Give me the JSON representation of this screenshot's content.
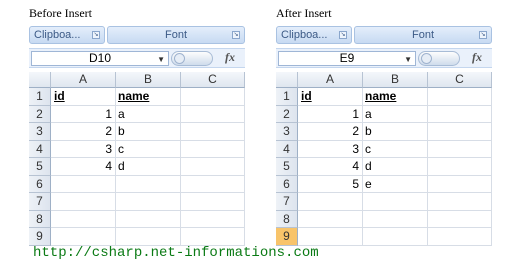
{
  "left": {
    "caption": "Before Insert",
    "ribbon": {
      "clipboard": "Clipboa...",
      "font": "Font"
    },
    "name_box": "D10",
    "fx": "fx",
    "columns": [
      "A",
      "B",
      "C"
    ],
    "rows": [
      {
        "num": "1",
        "a": "id",
        "b": "name",
        "c": ""
      },
      {
        "num": "2",
        "a": "1",
        "b": "a",
        "c": ""
      },
      {
        "num": "3",
        "a": "2",
        "b": "b",
        "c": ""
      },
      {
        "num": "4",
        "a": "3",
        "b": "c",
        "c": ""
      },
      {
        "num": "5",
        "a": "4",
        "b": "d",
        "c": ""
      },
      {
        "num": "6",
        "a": "",
        "b": "",
        "c": ""
      },
      {
        "num": "7",
        "a": "",
        "b": "",
        "c": ""
      },
      {
        "num": "8",
        "a": "",
        "b": "",
        "c": ""
      },
      {
        "num": "9",
        "a": "",
        "b": "",
        "c": ""
      }
    ]
  },
  "right": {
    "caption": "After Insert",
    "ribbon": {
      "clipboard": "Clipboa...",
      "font": "Font"
    },
    "name_box": "E9",
    "fx": "fx",
    "columns": [
      "A",
      "B",
      "C"
    ],
    "selected_row": "9",
    "rows": [
      {
        "num": "1",
        "a": "id",
        "b": "name",
        "c": ""
      },
      {
        "num": "2",
        "a": "1",
        "b": "a",
        "c": ""
      },
      {
        "num": "3",
        "a": "2",
        "b": "b",
        "c": ""
      },
      {
        "num": "4",
        "a": "3",
        "b": "c",
        "c": ""
      },
      {
        "num": "5",
        "a": "4",
        "b": "d",
        "c": ""
      },
      {
        "num": "6",
        "a": "5",
        "b": "e",
        "c": ""
      },
      {
        "num": "7",
        "a": "",
        "b": "",
        "c": ""
      },
      {
        "num": "8",
        "a": "",
        "b": "",
        "c": ""
      },
      {
        "num": "9",
        "a": "",
        "b": "",
        "c": ""
      }
    ]
  },
  "footer_url": "http://csharp.net-informations.com",
  "colors": {
    "footer": "#0a7a14",
    "selected_row_header": "#f8c46a",
    "ribbon": "#c7daf2"
  },
  "icons": {
    "dialog_launcher": "dialog-launcher-icon",
    "dropdown": "chevron-down-icon"
  }
}
